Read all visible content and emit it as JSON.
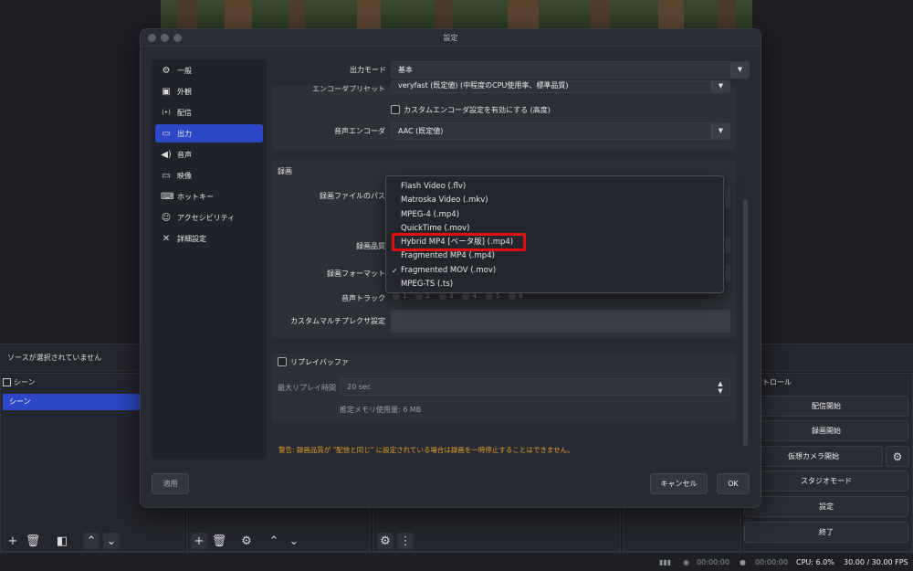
{
  "dialog": {
    "title": "設定",
    "nav": [
      {
        "label": "一般",
        "icon": "gear-icon",
        "glyph": "⚙"
      },
      {
        "label": "外観",
        "icon": "appearance-icon",
        "glyph": "▣"
      },
      {
        "label": "配信",
        "icon": "antenna-icon",
        "glyph": "((•))"
      },
      {
        "label": "出力",
        "icon": "monitor-output-icon",
        "glyph": "▭"
      },
      {
        "label": "音声",
        "icon": "speaker-icon",
        "glyph": "🔊"
      },
      {
        "label": "映像",
        "icon": "display-icon",
        "glyph": "▭"
      },
      {
        "label": "ホットキー",
        "icon": "keyboard-icon",
        "glyph": "⌨"
      },
      {
        "label": "アクセシビリティ",
        "icon": "accessibility-icon",
        "glyph": "♿"
      },
      {
        "label": "詳細設定",
        "icon": "tools-icon",
        "glyph": "✂"
      }
    ],
    "active_nav": "出力",
    "output_mode_label": "出力モード",
    "output_mode_value": "基本",
    "encoder_preset_label": "エンコーダプリセット",
    "encoder_preset_value": "veryfast (既定値) (中程度のCPU使用率、標準品質)",
    "custom_encoder_label": "カスタムエンコーダ設定を有効にする (高度)",
    "audio_encoder_label": "音声エンコーダ",
    "audio_encoder_value": "AAC (既定値)",
    "recording": {
      "section_title": "録画",
      "path_label": "録画ファイルのパス",
      "quality_label": "録画品質",
      "format_label": "録画フォーマット",
      "audio_track_label": "音声トラック",
      "tracks": [
        "1",
        "2",
        "3",
        "4",
        "5",
        "6"
      ],
      "custom_muxer_label": "カスタムマルチプレクサ設定"
    },
    "replay": {
      "label": "リプレイバッファ",
      "max_time_label": "最大リプレイ時間",
      "max_time_value": "20 sec",
      "memory_estimate": "推定メモリ使用量: 6 MB"
    },
    "warning": "警告: 録画品質が \"配信と同じ\" に設定されている場合は録画を一時停止することはできません。",
    "apply_button": "適用",
    "cancel_button": "キャンセル",
    "ok_button": "OK",
    "format_options": [
      {
        "label": "Flash Video (.flv)",
        "checked": false
      },
      {
        "label": "Matroska Video (.mkv)",
        "checked": false
      },
      {
        "label": "MPEG-4 (.mp4)",
        "checked": false
      },
      {
        "label": "QuickTime (.mov)",
        "checked": false
      },
      {
        "label": "Hybrid MP4 [ベータ版] (.mp4)",
        "checked": false
      },
      {
        "label": "Fragmented MP4 (.mp4)",
        "checked": false
      },
      {
        "label": "Fragmented MOV (.mov)",
        "checked": true
      },
      {
        "label": "MPEG-TS (.ts)",
        "checked": false
      }
    ],
    "check_glyph": "✓"
  },
  "main": {
    "no_source": "ソースが選択されていません",
    "scenes_title": "シーン",
    "scene_item": "シーン",
    "controls_title": "コントロール",
    "controls": [
      "配信開始",
      "録画開始",
      "仮想カメラ開始",
      "スタジオモード",
      "設定",
      "終了"
    ],
    "status": {
      "rec_time": "00:00:00",
      "stream_time": "00:00:00",
      "cpu": "CPU: 6.0%",
      "fps": "30.00 / 30.00 FPS"
    }
  },
  "colors": {
    "accent": "#2c48c6",
    "highlight": "#e01010",
    "warning": "#e0a030"
  }
}
